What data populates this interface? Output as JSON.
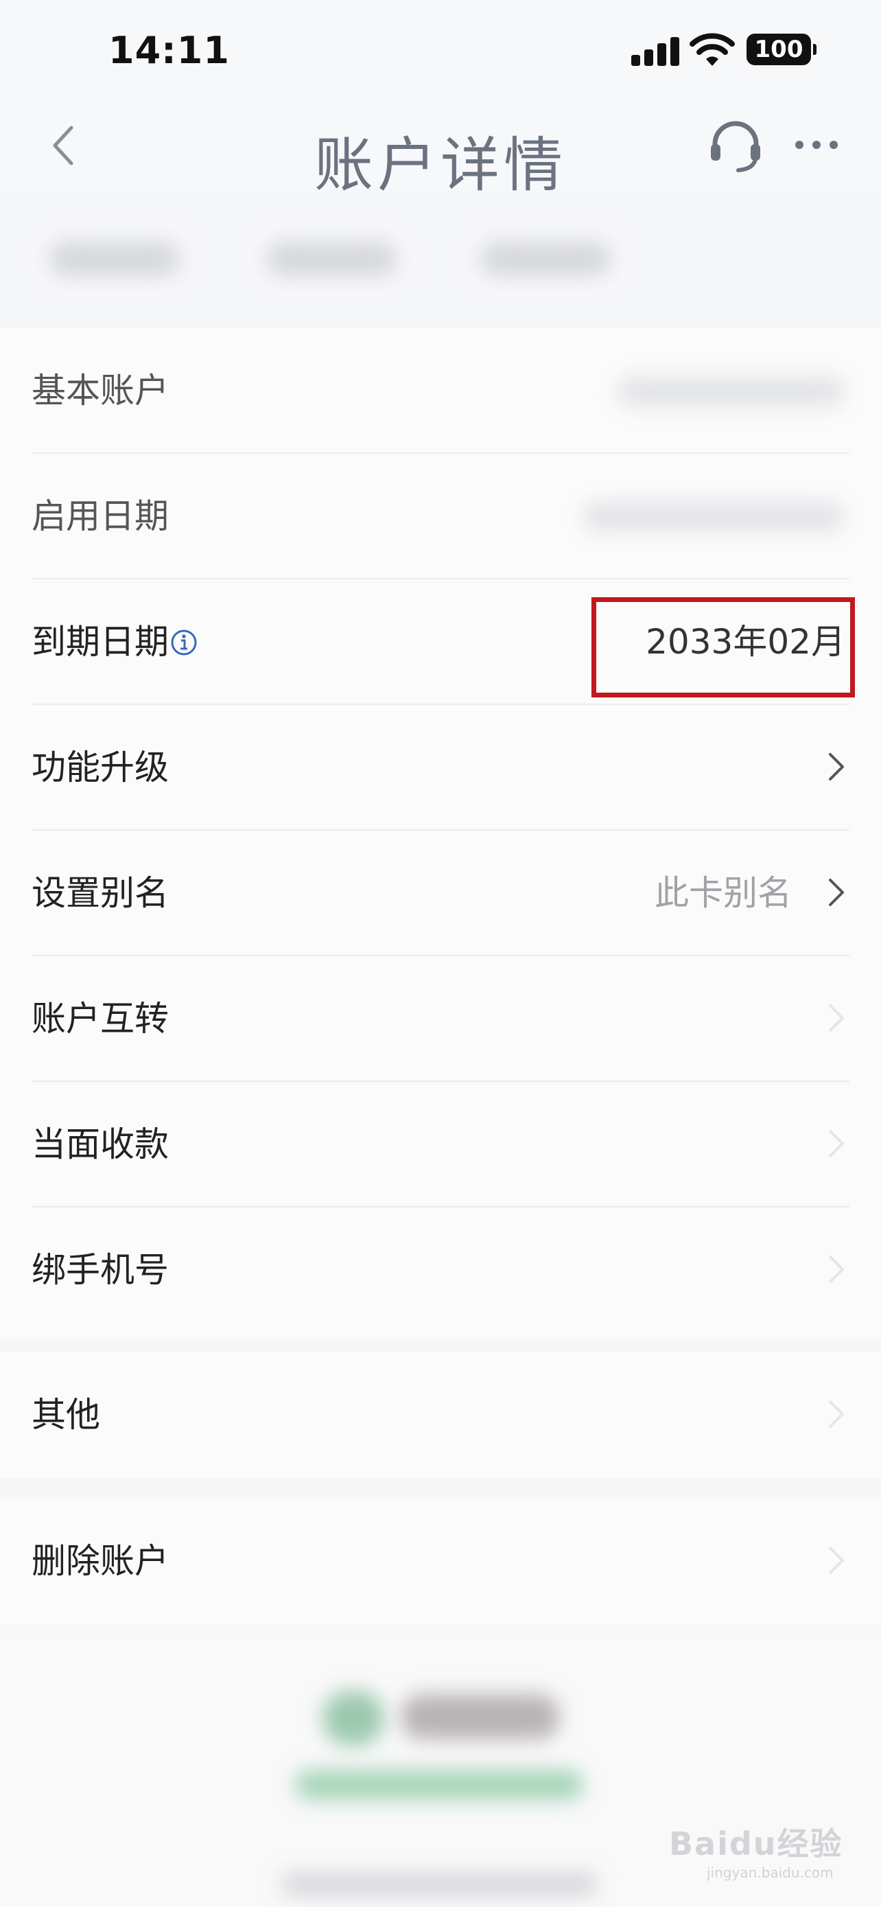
{
  "status_bar": {
    "time": "14:11",
    "battery": "100"
  },
  "nav": {
    "title": "账户详情"
  },
  "rows_group1": [
    {
      "label": "基本账户"
    },
    {
      "label": "启用日期"
    },
    {
      "label": "到期日期",
      "value": "2033年02月"
    },
    {
      "label": "功能升级"
    },
    {
      "label": "设置别名",
      "value": "此卡别名"
    },
    {
      "label": "账户互转"
    },
    {
      "label": "当面收款"
    },
    {
      "label": "绑手机号"
    }
  ],
  "rows_group2": [
    {
      "label": "其他"
    }
  ],
  "rows_group3": [
    {
      "label": "删除账户"
    }
  ],
  "watermark": {
    "brand": "Baidu经验",
    "url": "jingyan.baidu.com"
  },
  "colors": {
    "highlight": "#c0191f",
    "info_icon": "#3b66b8"
  }
}
